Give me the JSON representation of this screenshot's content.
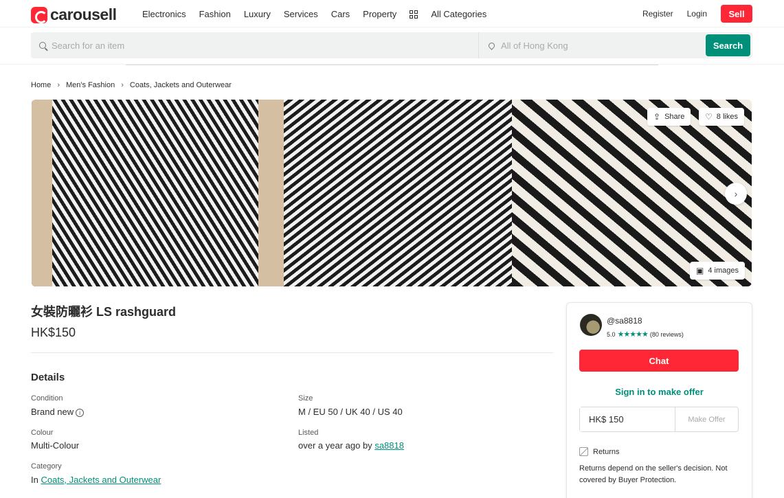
{
  "header": {
    "brand": "carousell",
    "nav": [
      "Electronics",
      "Fashion",
      "Luxury",
      "Services",
      "Cars",
      "Property"
    ],
    "all_categories": "All Categories",
    "register": "Register",
    "login": "Login",
    "sell": "Sell"
  },
  "search": {
    "item_placeholder": "Search for an item",
    "location_placeholder": "All of Hong Kong",
    "button": "Search"
  },
  "breadcrumb": [
    "Home",
    "Men's Fashion",
    "Coats, Jackets and Outerwear"
  ],
  "gallery": {
    "share": "Share",
    "likes": "8 likes",
    "image_count": "4 images"
  },
  "listing": {
    "title": "女裝防曬衫 LS rashguard",
    "price": "HK$150",
    "details_heading": "Details",
    "condition_label": "Condition",
    "condition_value": "Brand new",
    "size_label": "Size",
    "size_value": "M / EU 50 / UK 40 / US 40",
    "colour_label": "Colour",
    "colour_value": "Multi-Colour",
    "listed_label": "Listed",
    "listed_prefix": "over a year ago by",
    "listed_user": "sa8818",
    "category_label": "Category",
    "category_prefix": "In",
    "category_link": "Coats, Jackets and Outerwear"
  },
  "seller": {
    "username": "@sa8818",
    "rating": "5.0",
    "stars": "★★★★★",
    "reviews": "(80 reviews)",
    "chat": "Chat",
    "sign_in_offer": "Sign in to make offer",
    "offer_value": "HK$ 150",
    "make_offer": "Make Offer",
    "returns_title": "Returns",
    "returns_desc": "Returns depend on the seller's decision. Not covered by Buyer Protection."
  },
  "colors": {
    "brand_red": "#ff2636",
    "accent_green": "#008f79"
  }
}
